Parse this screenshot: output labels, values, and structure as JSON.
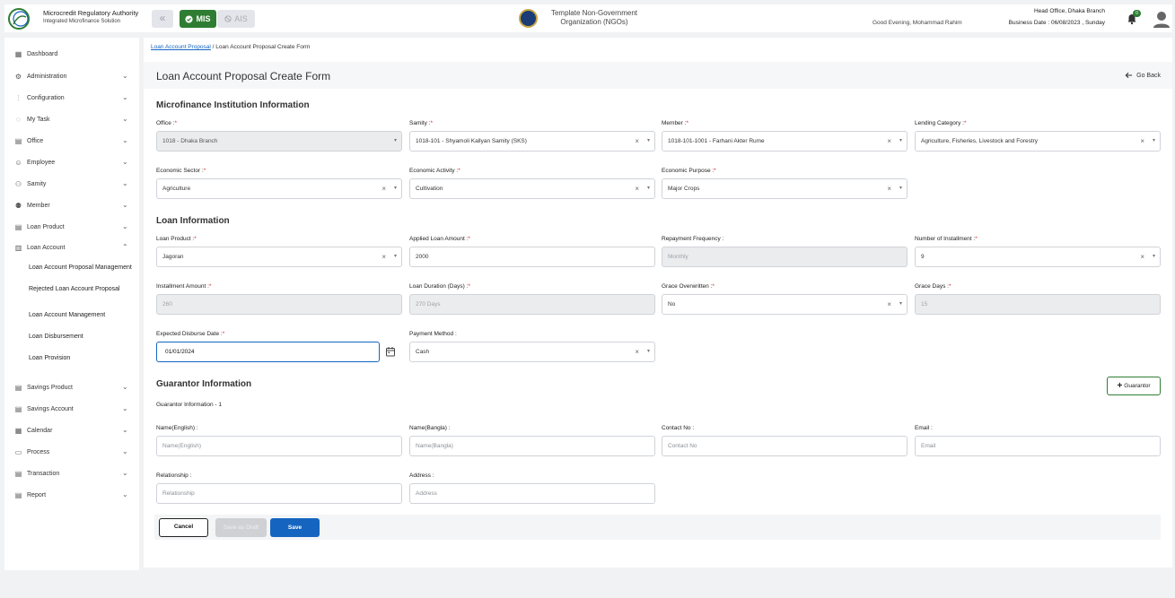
{
  "header": {
    "brand_title": "Microcredit Regulatory Authority",
    "brand_subtitle": "Integrated Microfinance Solution",
    "mis_label": "MIS",
    "ais_label": "AIS",
    "org_name": "Template Non-Government Organization (NGOs)",
    "greeting": "Good Evening, Mohammad Rahim",
    "head_office": "Head Office, Dhaka Branch",
    "business_date": "Business Date : 06/08/2023 , Sunday",
    "notification_count": "0",
    "colors": {
      "accent_green": "#2e7d32",
      "primary_blue": "#1565c0"
    }
  },
  "sidebar": {
    "dashboard": "Dashboard",
    "items": [
      {
        "label": "Administration",
        "icon": "admin-icon"
      },
      {
        "label": "Configuration",
        "icon": "sliders-icon"
      },
      {
        "label": "My Task",
        "icon": "task-icon"
      },
      {
        "label": "Office",
        "icon": "office-icon"
      },
      {
        "label": "Employee",
        "icon": "employee-icon"
      },
      {
        "label": "Samity",
        "icon": "samity-icon"
      },
      {
        "label": "Member",
        "icon": "member-icon"
      },
      {
        "label": "Loan Product",
        "icon": "loan-product-icon"
      },
      {
        "label": "Loan Account",
        "icon": "loan-account-icon"
      }
    ],
    "loan_account_sub": [
      "Loan Account Proposal Management",
      "Rejected Loan Account Proposal",
      "Loan Account Management",
      "Loan Disbursement",
      "Loan Provision"
    ],
    "items_after": [
      {
        "label": "Savings Product",
        "icon": "savings-product-icon"
      },
      {
        "label": "Savings Account",
        "icon": "savings-account-icon"
      },
      {
        "label": "Calendar",
        "icon": "calendar-icon"
      },
      {
        "label": "Process",
        "icon": "process-icon"
      },
      {
        "label": "Transaction",
        "icon": "transaction-icon"
      },
      {
        "label": "Report",
        "icon": "report-icon"
      }
    ]
  },
  "breadcrumb": {
    "link": "Loan Account Proposal",
    "separator": "/",
    "current": "Loan Account Proposal Create Form"
  },
  "page": {
    "title": "Loan Account Proposal Create Form",
    "go_back": "Go Back"
  },
  "sections": {
    "mfi": "Microfinance Institution Information",
    "loan": "Loan Information",
    "guarantor": "Guarantor Information",
    "guarantor_sub": "Guarantor Information - 1"
  },
  "fields": {
    "office": {
      "label": "Office :",
      "value": "1018 - Dhaka Branch"
    },
    "samity": {
      "label": "Samity :",
      "value": "1018-101 - Shyamoli Kallyan Samity (SKS)"
    },
    "member": {
      "label": "Member :",
      "value": "1018-101-1001 - Farhani Akter Rume"
    },
    "lending_category": {
      "label": "Lending Category :",
      "value": "Agriculture, Fisheries, Livestock and Forestry"
    },
    "economic_sector": {
      "label": "Economic Sector :",
      "value": "Agriculture"
    },
    "economic_activity": {
      "label": "Economic Activity :",
      "value": "Cultivation"
    },
    "economic_purpose": {
      "label": "Economic Purpose :",
      "value": "Major Crops"
    },
    "loan_product": {
      "label": "Loan Product :",
      "value": "Jagoran"
    },
    "applied_amount": {
      "label": "Applied Loan Amount :",
      "value": "2000"
    },
    "repayment_frequency": {
      "label": "Repayment Frequency :",
      "value": "Monthly"
    },
    "num_installment": {
      "label": "Number of Installment :",
      "value": "9"
    },
    "installment_amount": {
      "label": "Installment Amount :",
      "value": "260"
    },
    "loan_duration": {
      "label": "Loan Duration (Days) :",
      "value": "270 Days"
    },
    "grace_overwritten": {
      "label": "Grace Overwritten :",
      "value": "No"
    },
    "grace_days": {
      "label": "Grace Days :",
      "value": "15"
    },
    "disburse_date": {
      "label": "Expected Disburse Date :",
      "value": "01/01/2024"
    },
    "payment_method": {
      "label": "Payment Method :",
      "value": "Cash"
    },
    "name_en": {
      "label": "Name(English) :",
      "placeholder": "Name(English)"
    },
    "name_bn": {
      "label": "Name(Bangla) :",
      "placeholder": "Name(Bangla)"
    },
    "contact": {
      "label": "Contact No :",
      "placeholder": "Contact No"
    },
    "email": {
      "label": "Email :",
      "placeholder": "Email"
    },
    "relationship": {
      "label": "Relationship :",
      "placeholder": "Relationship"
    },
    "address": {
      "label": "Address :",
      "placeholder": "Address"
    }
  },
  "required_mark": "*",
  "buttons": {
    "guarantor": "Guarantor",
    "cancel": "Cancel",
    "draft": "Save as Draft",
    "save": "Save"
  }
}
